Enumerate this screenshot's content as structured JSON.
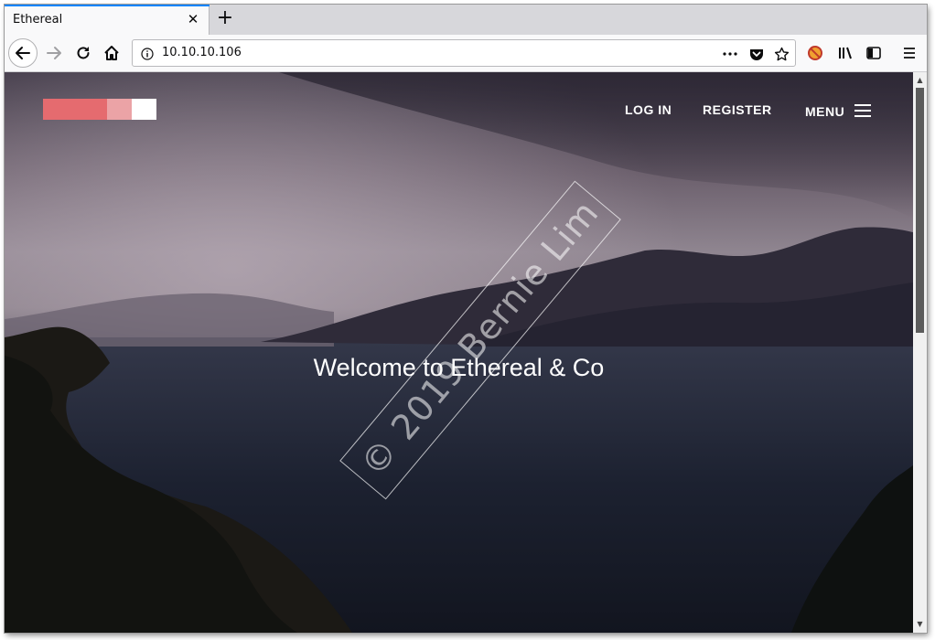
{
  "tab": {
    "title": "Ethereal",
    "close_glyph": "✕",
    "new_tab_glyph": "+"
  },
  "toolbar": {
    "url": "10.10.10.106",
    "icons": [
      "back-icon",
      "forward-icon",
      "reload-icon",
      "home-icon",
      "info-icon",
      "page-actions-icon",
      "pocket-icon",
      "bookmark-star-icon",
      "addon-icon",
      "library-icon",
      "sidebar-icon",
      "hamburger-menu-icon"
    ]
  },
  "site": {
    "nav": {
      "login": "LOG IN",
      "register": "REGISTER",
      "menu": "MENU"
    },
    "hero_title": "Welcome to Ethereal & Co",
    "watermark": "© 2019 Bernie Lim"
  },
  "colors": {
    "accent": "#0a84ff",
    "logo_dark": "#e56b6f",
    "logo_light": "#eba3a6",
    "logo_white": "#ffffff"
  }
}
